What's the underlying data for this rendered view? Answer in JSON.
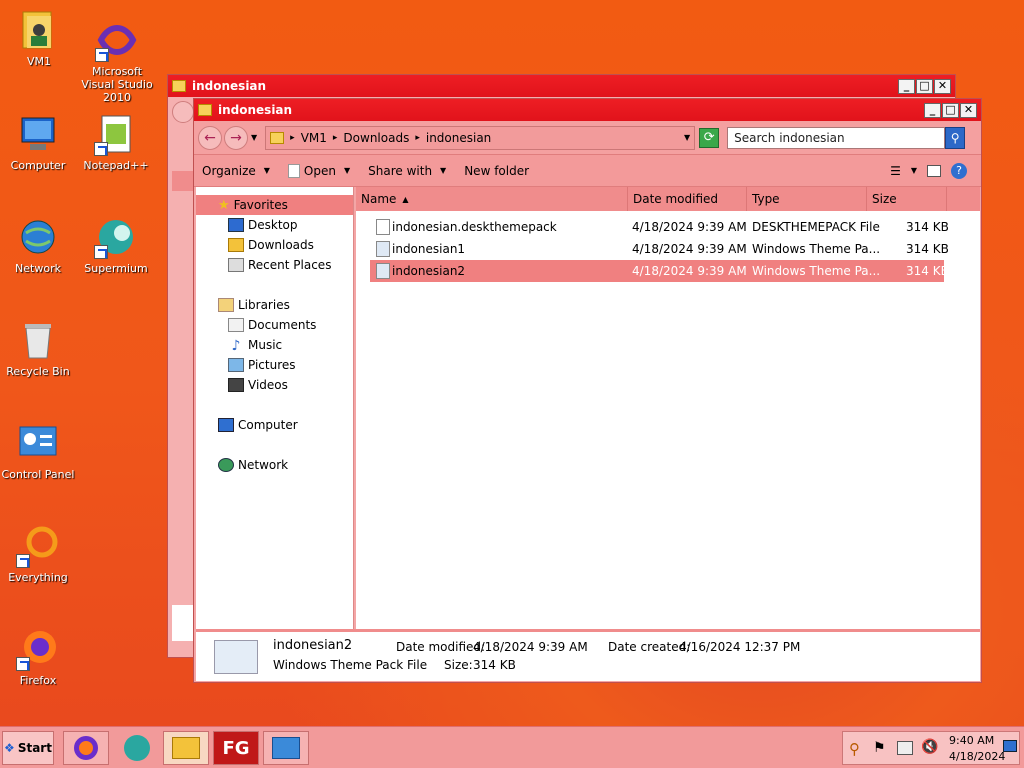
{
  "desktop": {
    "icons": [
      {
        "label": "VM1",
        "icon": "user-folder-icon"
      },
      {
        "label": "Microsoft Visual Studio 2010",
        "icon": "visual-studio-icon"
      },
      {
        "label": "Computer",
        "icon": "computer-icon"
      },
      {
        "label": "Notepad++",
        "icon": "notepadpp-icon"
      },
      {
        "label": "Network",
        "icon": "network-icon"
      },
      {
        "label": "Supermium",
        "icon": "supermium-icon"
      },
      {
        "label": "Recycle Bin",
        "icon": "recycle-bin-icon"
      },
      {
        "label": "Control Panel",
        "icon": "control-panel-icon"
      },
      {
        "label": "Everything",
        "icon": "everything-icon"
      },
      {
        "label": "Firefox",
        "icon": "firefox-icon"
      }
    ]
  },
  "back_window": {
    "title": "indonesian"
  },
  "window": {
    "title": "indonesian",
    "address": [
      "VM1",
      "Downloads",
      "indonesian"
    ],
    "search_placeholder": "Search indonesian",
    "toolbar": {
      "organize": "Organize",
      "open": "Open",
      "share": "Share with",
      "new_folder": "New folder"
    },
    "nav": {
      "favorites": "Favorites",
      "desktop": "Desktop",
      "downloads": "Downloads",
      "recent": "Recent Places",
      "libraries": "Libraries",
      "documents": "Documents",
      "music": "Music",
      "pictures": "Pictures",
      "videos": "Videos",
      "computer": "Computer",
      "network": "Network"
    },
    "columns": {
      "name": "Name",
      "date": "Date modified",
      "type": "Type",
      "size": "Size"
    },
    "files": [
      {
        "name": "indonesian.deskthemepack",
        "date": "4/18/2024 9:39 AM",
        "type": "DESKTHEMEPACK File",
        "size": "314 KB",
        "selected": false
      },
      {
        "name": "indonesian1",
        "date": "4/18/2024 9:39 AM",
        "type": "Windows Theme Pa...",
        "size": "314 KB",
        "selected": false
      },
      {
        "name": "indonesian2",
        "date": "4/18/2024 9:39 AM",
        "type": "Windows Theme Pa...",
        "size": "314 KB",
        "selected": true
      }
    ],
    "details": {
      "name": "indonesian2",
      "type": "Windows Theme Pack File",
      "modified_label": "Date modified:",
      "modified": "4/18/2024 9:39 AM",
      "created_label": "Date created:",
      "created": "4/16/2024 12:37 PM",
      "size_label": "Size:",
      "size": "314 KB"
    }
  },
  "taskbar": {
    "start": "Start",
    "apps": [
      "firefox-icon",
      "supermium-icon",
      "explorer-icon",
      "fg-app-icon",
      "control-panel-icon"
    ],
    "fg_label": "FG",
    "time": "9:40 AM",
    "date": "4/18/2024"
  }
}
